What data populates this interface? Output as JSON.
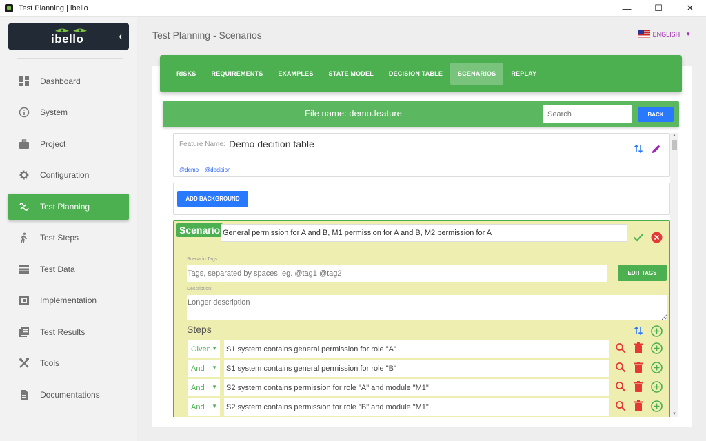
{
  "window": {
    "title": "Test Planning | ibello",
    "controls": [
      "—",
      "☐",
      "✕"
    ]
  },
  "sidebar": {
    "logo": "ibello",
    "items": [
      {
        "label": "Dashboard",
        "icon": "dashboard-icon",
        "active": false
      },
      {
        "label": "System",
        "icon": "info-icon",
        "active": false
      },
      {
        "label": "Project",
        "icon": "briefcase-icon",
        "active": false
      },
      {
        "label": "Configuration",
        "icon": "gear-icon",
        "active": false
      },
      {
        "label": "Test Planning",
        "icon": "gesture-icon",
        "active": true
      },
      {
        "label": "Test Steps",
        "icon": "walk-icon",
        "active": false
      },
      {
        "label": "Test Data",
        "icon": "list-icon",
        "active": false
      },
      {
        "label": "Implementation",
        "icon": "code-block-icon",
        "active": false
      },
      {
        "label": "Test Results",
        "icon": "library-icon",
        "active": false
      },
      {
        "label": "Tools",
        "icon": "tools-icon",
        "active": false
      },
      {
        "label": "Documentations",
        "icon": "document-icon",
        "active": false
      }
    ]
  },
  "header": {
    "title": "Test Planning - Scenarios",
    "language": "ENGLISH"
  },
  "tabs": [
    {
      "label": "RISKS",
      "active": false
    },
    {
      "label": "REQUIREMENTS",
      "active": false
    },
    {
      "label": "EXAMPLES",
      "active": false
    },
    {
      "label": "STATE MODEL",
      "active": false
    },
    {
      "label": "DECISION TABLE",
      "active": false
    },
    {
      "label": "SCENARIOS",
      "active": true
    },
    {
      "label": "REPLAY",
      "active": false
    }
  ],
  "filebar": {
    "file_name": "File name: demo.feature",
    "search_placeholder": "Search",
    "back_label": "BACK"
  },
  "feature": {
    "label": "Feature Name:",
    "name": "Demo decition table",
    "tags": [
      "@demo",
      "@decision"
    ]
  },
  "background": {
    "add_label": "ADD BACKGROUND"
  },
  "scenario": {
    "badge": "Scenario",
    "name": "General permission for A and B, M1 permission for A and B, M2 permission for A",
    "tags_label": "Scenario Tags:",
    "tags_placeholder": "Tags, separated by spaces, eg. @tag1 @tag2",
    "edit_tags_label": "EDIT TAGS",
    "description_label": "Description:",
    "description_placeholder": "Longer description",
    "steps_title": "Steps",
    "steps": [
      {
        "keyword": "Given",
        "text": "S1 system contains general permission for role \"A\""
      },
      {
        "keyword": "And",
        "text": "S1 system contains general permission for role \"B\""
      },
      {
        "keyword": "And",
        "text": "S2 system contains permission for role \"A\" and module \"M1\""
      },
      {
        "keyword": "And",
        "text": "S2 system contains permission for role \"B\" and module \"M1\""
      }
    ]
  },
  "colors": {
    "green": "#4caf50",
    "blue": "#2979ff",
    "scenario_bg": "#eeeeb0",
    "danger": "#e53935",
    "purple": "#9c27b0"
  }
}
